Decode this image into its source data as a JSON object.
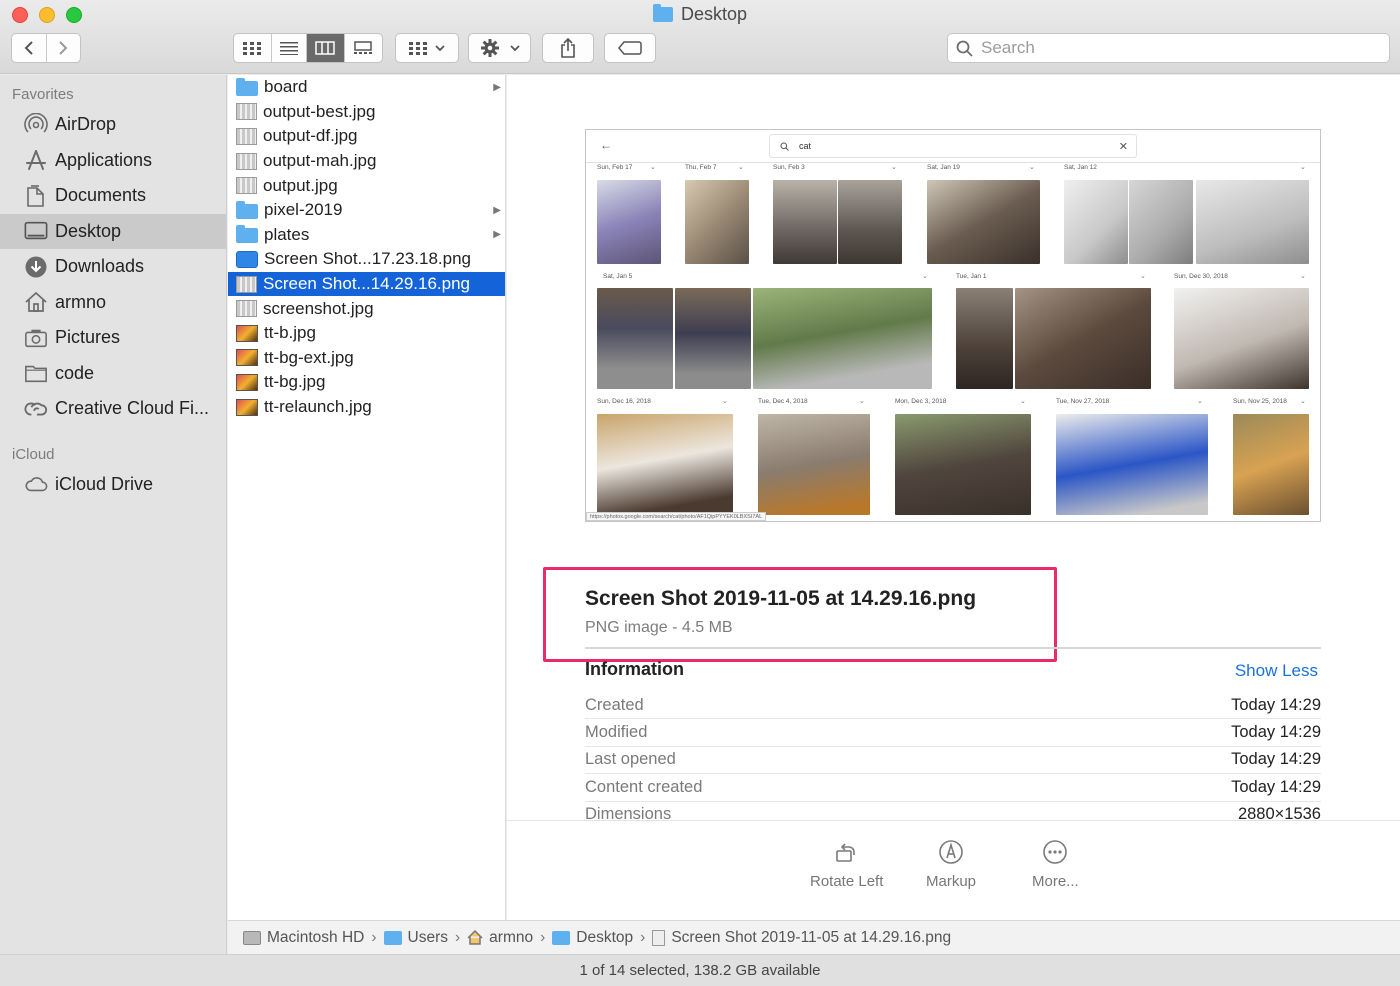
{
  "window": {
    "title": "Desktop"
  },
  "toolbar": {
    "back_label": "‹",
    "forward_label": "›",
    "search_placeholder": "Search"
  },
  "sidebar": {
    "sections": [
      {
        "title": "Favorites",
        "items": [
          {
            "label": "AirDrop",
            "icon": "airdrop-icon"
          },
          {
            "label": "Applications",
            "icon": "applications-icon"
          },
          {
            "label": "Documents",
            "icon": "documents-icon"
          },
          {
            "label": "Desktop",
            "icon": "desktop-icon",
            "selected": true
          },
          {
            "label": "Downloads",
            "icon": "downloads-icon"
          },
          {
            "label": "armno",
            "icon": "home-icon"
          },
          {
            "label": "Pictures",
            "icon": "pictures-icon"
          },
          {
            "label": "code",
            "icon": "folder-icon"
          },
          {
            "label": "Creative Cloud Fi...",
            "icon": "creative-cloud-icon"
          }
        ]
      },
      {
        "title": "iCloud",
        "items": [
          {
            "label": "iCloud Drive",
            "icon": "cloud-icon"
          }
        ]
      }
    ]
  },
  "files": [
    {
      "name": "board",
      "type": "folder",
      "has_children": true
    },
    {
      "name": "output-best.jpg",
      "type": "img"
    },
    {
      "name": "output-df.jpg",
      "type": "img"
    },
    {
      "name": "output-mah.jpg",
      "type": "img"
    },
    {
      "name": "output.jpg",
      "type": "img"
    },
    {
      "name": "pixel-2019",
      "type": "folder",
      "has_children": true
    },
    {
      "name": "plates",
      "type": "folder",
      "has_children": true
    },
    {
      "name": "Screen Shot...17.23.18.png",
      "type": "png"
    },
    {
      "name": "Screen Shot...14.29.16.png",
      "type": "img",
      "selected": true
    },
    {
      "name": "screenshot.jpg",
      "type": "img"
    },
    {
      "name": "tt-b.jpg",
      "type": "color"
    },
    {
      "name": "tt-bg-ext.jpg",
      "type": "color"
    },
    {
      "name": "tt-bg.jpg",
      "type": "color"
    },
    {
      "name": "tt-relaunch.jpg",
      "type": "color"
    }
  ],
  "preview": {
    "thumbnail": {
      "search_text": "cat",
      "url_text": "https://photos.google.com/search/cat/photo/AF1QipPYYEK0LBXSI7AL",
      "date_labels": [
        "Sun, Feb 17",
        "Thu, Feb 7",
        "Sun, Feb 3",
        "Sat, Jan 19",
        "Sat, Jan 12",
        "Sat, Jan 5",
        "Tue, Jan 1",
        "Sun, Dec 30, 2018",
        "Sun, Dec 16, 2018",
        "Tue, Dec 4, 2018",
        "Mon, Dec 3, 2018",
        "Tue, Nov 27, 2018",
        "Sun, Nov 25, 2018"
      ]
    },
    "file_name": "Screen Shot 2019-11-05 at 14.29.16.png",
    "file_meta": "PNG image - 4.5 MB",
    "info_heading": "Information",
    "show_less_label": "Show Less",
    "info": [
      {
        "key": "Created",
        "value": "Today 14:29"
      },
      {
        "key": "Modified",
        "value": "Today 14:29"
      },
      {
        "key": "Last opened",
        "value": "Today 14:29"
      },
      {
        "key": "Content created",
        "value": "Today 14:29"
      },
      {
        "key": "Dimensions",
        "value": "2880×1536"
      }
    ],
    "actions": [
      {
        "label": "Rotate Left",
        "icon": "rotate-left-icon"
      },
      {
        "label": "Markup",
        "icon": "markup-icon"
      },
      {
        "label": "More...",
        "icon": "more-icon"
      }
    ]
  },
  "pathbar": [
    "Macintosh HD",
    "Users",
    "armno",
    "Desktop",
    "Screen Shot 2019-11-05 at 14.29.16.png"
  ],
  "status": "1 of 14 selected, 138.2 GB available",
  "colors": {
    "accent": "#1463d8",
    "highlight": "#ea2a6a",
    "link": "#1a72d9"
  }
}
